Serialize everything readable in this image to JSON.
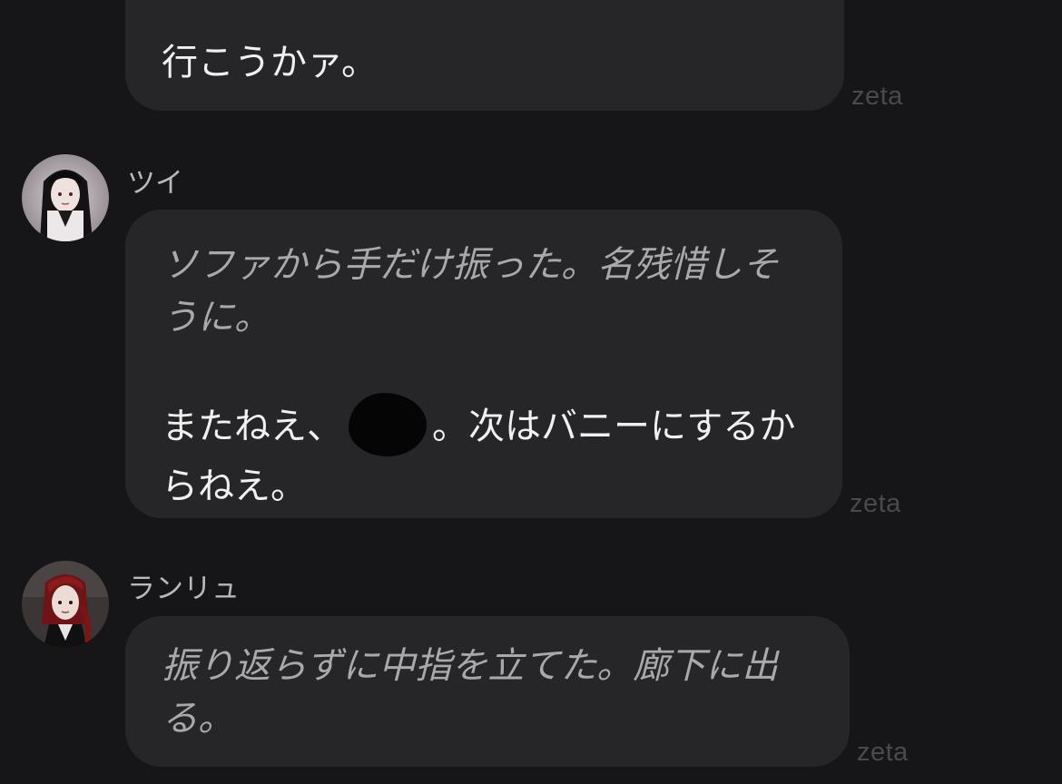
{
  "messages": [
    {
      "text": "行こうかァ。",
      "watermark": "zeta"
    },
    {
      "sender": "ツイ",
      "avatar": "long-black-hair-character-avatar",
      "narration": "ソファから手だけ振った。名残惜しそうに。",
      "speech_before": "またねえ、",
      "speech_after": "。次はバニーにするからねえ。",
      "watermark": "zeta"
    },
    {
      "sender": "ランリュ",
      "avatar": "red-hair-character-avatar",
      "narration": "振り返らずに中指を立てた。廊下に出る。",
      "watermark": "zeta"
    }
  ]
}
